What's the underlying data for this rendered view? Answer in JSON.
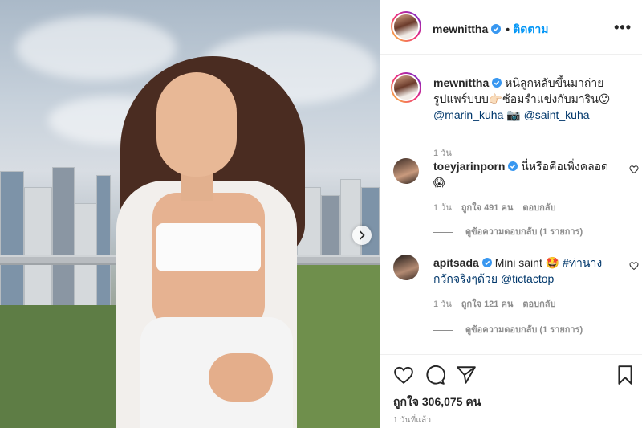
{
  "post": {
    "author": "mewnittha",
    "follow_label": "ติดตาม",
    "dot": "•",
    "more_label": "•••",
    "caption_text": "หนีลูกหลับขึ้นมาถ่ายรูปแพร์บบบ👉🏻ซ้อมรำแข่งกับมาริน😛",
    "caption_mention_1": "@marin_kuha",
    "caption_camera": "📷",
    "caption_mention_2": "@saint_kuha",
    "caption_time": "1 วัน",
    "likes_text": "ถูกใจ 306,075 คน",
    "posted_time": "1 วันที่แล้ว"
  },
  "comments": [
    {
      "username": "toeyjarinporn",
      "text": "นี่หรือคือเพิ่งคลอด😱",
      "time": "1 วัน",
      "likes": "ถูกใจ 491 คน",
      "reply_label": "ตอบกลับ",
      "view_replies": "ดูข้อความตอบกลับ (1 รายการ)"
    },
    {
      "username": "apitsada",
      "text_plain": "Mini saint 🤩 ",
      "hashtag": "#ท่านางกวักจริงๆด้วย",
      "mention": "@tictactop",
      "time": "1 วัน",
      "likes": "ถูกใจ 121 คน",
      "reply_label": "ตอบกลับ",
      "view_replies": "ดูข้อความตอบกลับ (1 รายการ)"
    }
  ],
  "icons": {
    "verified": "verified-badge",
    "heart": "heart-icon",
    "comment": "comment-icon",
    "share": "share-icon",
    "save": "bookmark-icon",
    "next": "chevron-right-icon"
  },
  "colors": {
    "accent": "#0095f6",
    "mention": "#00376b",
    "muted": "#8e8e8e"
  }
}
